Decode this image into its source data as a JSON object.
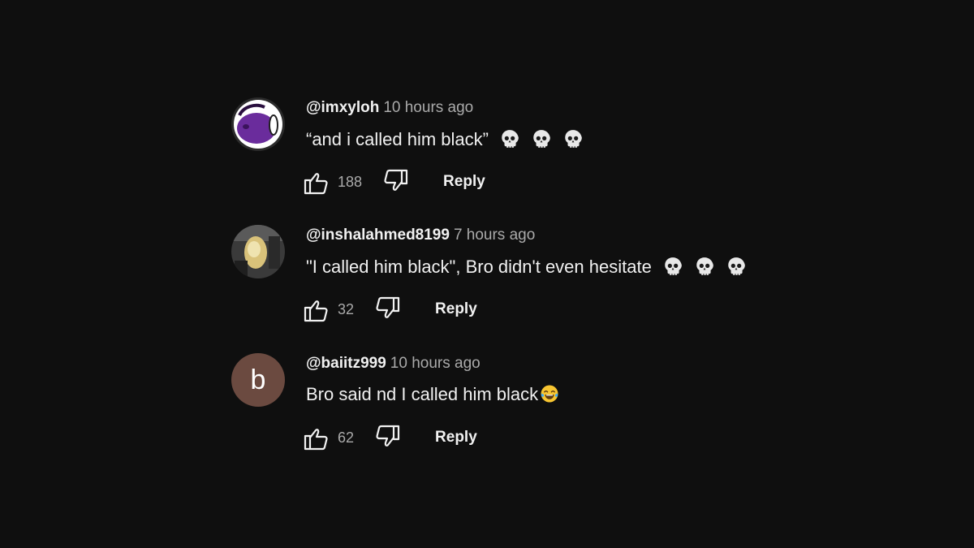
{
  "comments": [
    {
      "author": "@imxyloh",
      "time": "10 hours ago",
      "text": "“and i called him black”",
      "emojis": [
        "skull",
        "skull",
        "skull"
      ],
      "likes": "188",
      "reply_label": "Reply",
      "avatar": {
        "type": "image",
        "colors": [
          "#6a2c9c",
          "#ffffff"
        ]
      }
    },
    {
      "author": "@inshalahmed8199",
      "time": "7 hours ago",
      "text": "\"I called him black\", Bro didn't even hesitate",
      "emojis": [
        "skull",
        "skull",
        "skull"
      ],
      "likes": "32",
      "reply_label": "Reply",
      "avatar": {
        "type": "image",
        "colors": [
          "#3a3a3a",
          "#d9c27a"
        ]
      }
    },
    {
      "author": "@baiitz999",
      "time": "10 hours ago",
      "text": "Bro said nd I called him black",
      "emojis": [
        "face-with-tears-of-joy"
      ],
      "likes": "62",
      "reply_label": "Reply",
      "avatar": {
        "type": "letter",
        "letter": "b",
        "color": "#6b4a40"
      }
    }
  ],
  "icons": {
    "like": "thumbs-up-icon",
    "dislike": "thumbs-down-icon"
  }
}
